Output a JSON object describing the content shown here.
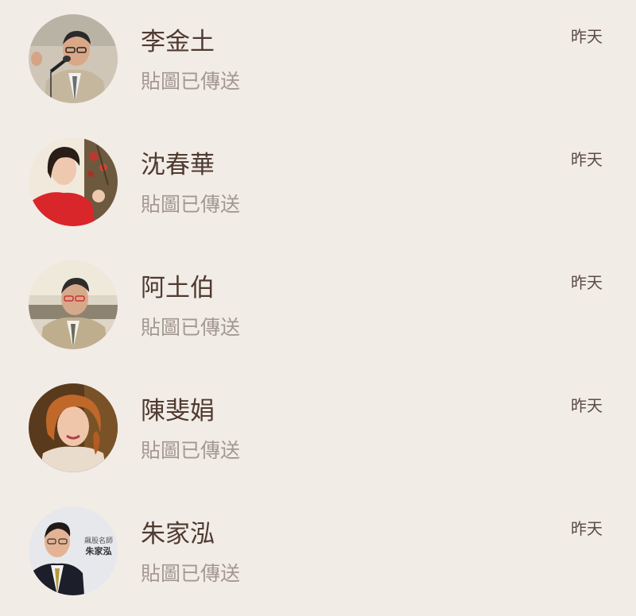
{
  "conversations": [
    {
      "name": "李金土",
      "preview": "貼圖已傳送",
      "time": "昨天",
      "avatar_icon": "elderly-man-speaking-avatar"
    },
    {
      "name": "沈春華",
      "preview": "貼圖已傳送",
      "time": "昨天",
      "avatar_icon": "woman-red-dress-avatar"
    },
    {
      "name": "阿土伯",
      "preview": "貼圖已傳送",
      "time": "昨天",
      "avatar_icon": "elderly-man-suit-avatar"
    },
    {
      "name": "陳斐娟",
      "preview": "貼圖已傳送",
      "time": "昨天",
      "avatar_icon": "woman-portrait-avatar"
    },
    {
      "name": "朱家泓",
      "preview": "貼圖已傳送",
      "time": "昨天",
      "avatar_icon": "man-suit-avatar",
      "avatar_caption_line1": "飆股名師",
      "avatar_caption_line2": "朱家泓"
    }
  ],
  "colors": {
    "background": "#f2ece7",
    "name_text": "#4f3a30",
    "preview_text": "#a39890",
    "time_text": "#5b4c45"
  }
}
